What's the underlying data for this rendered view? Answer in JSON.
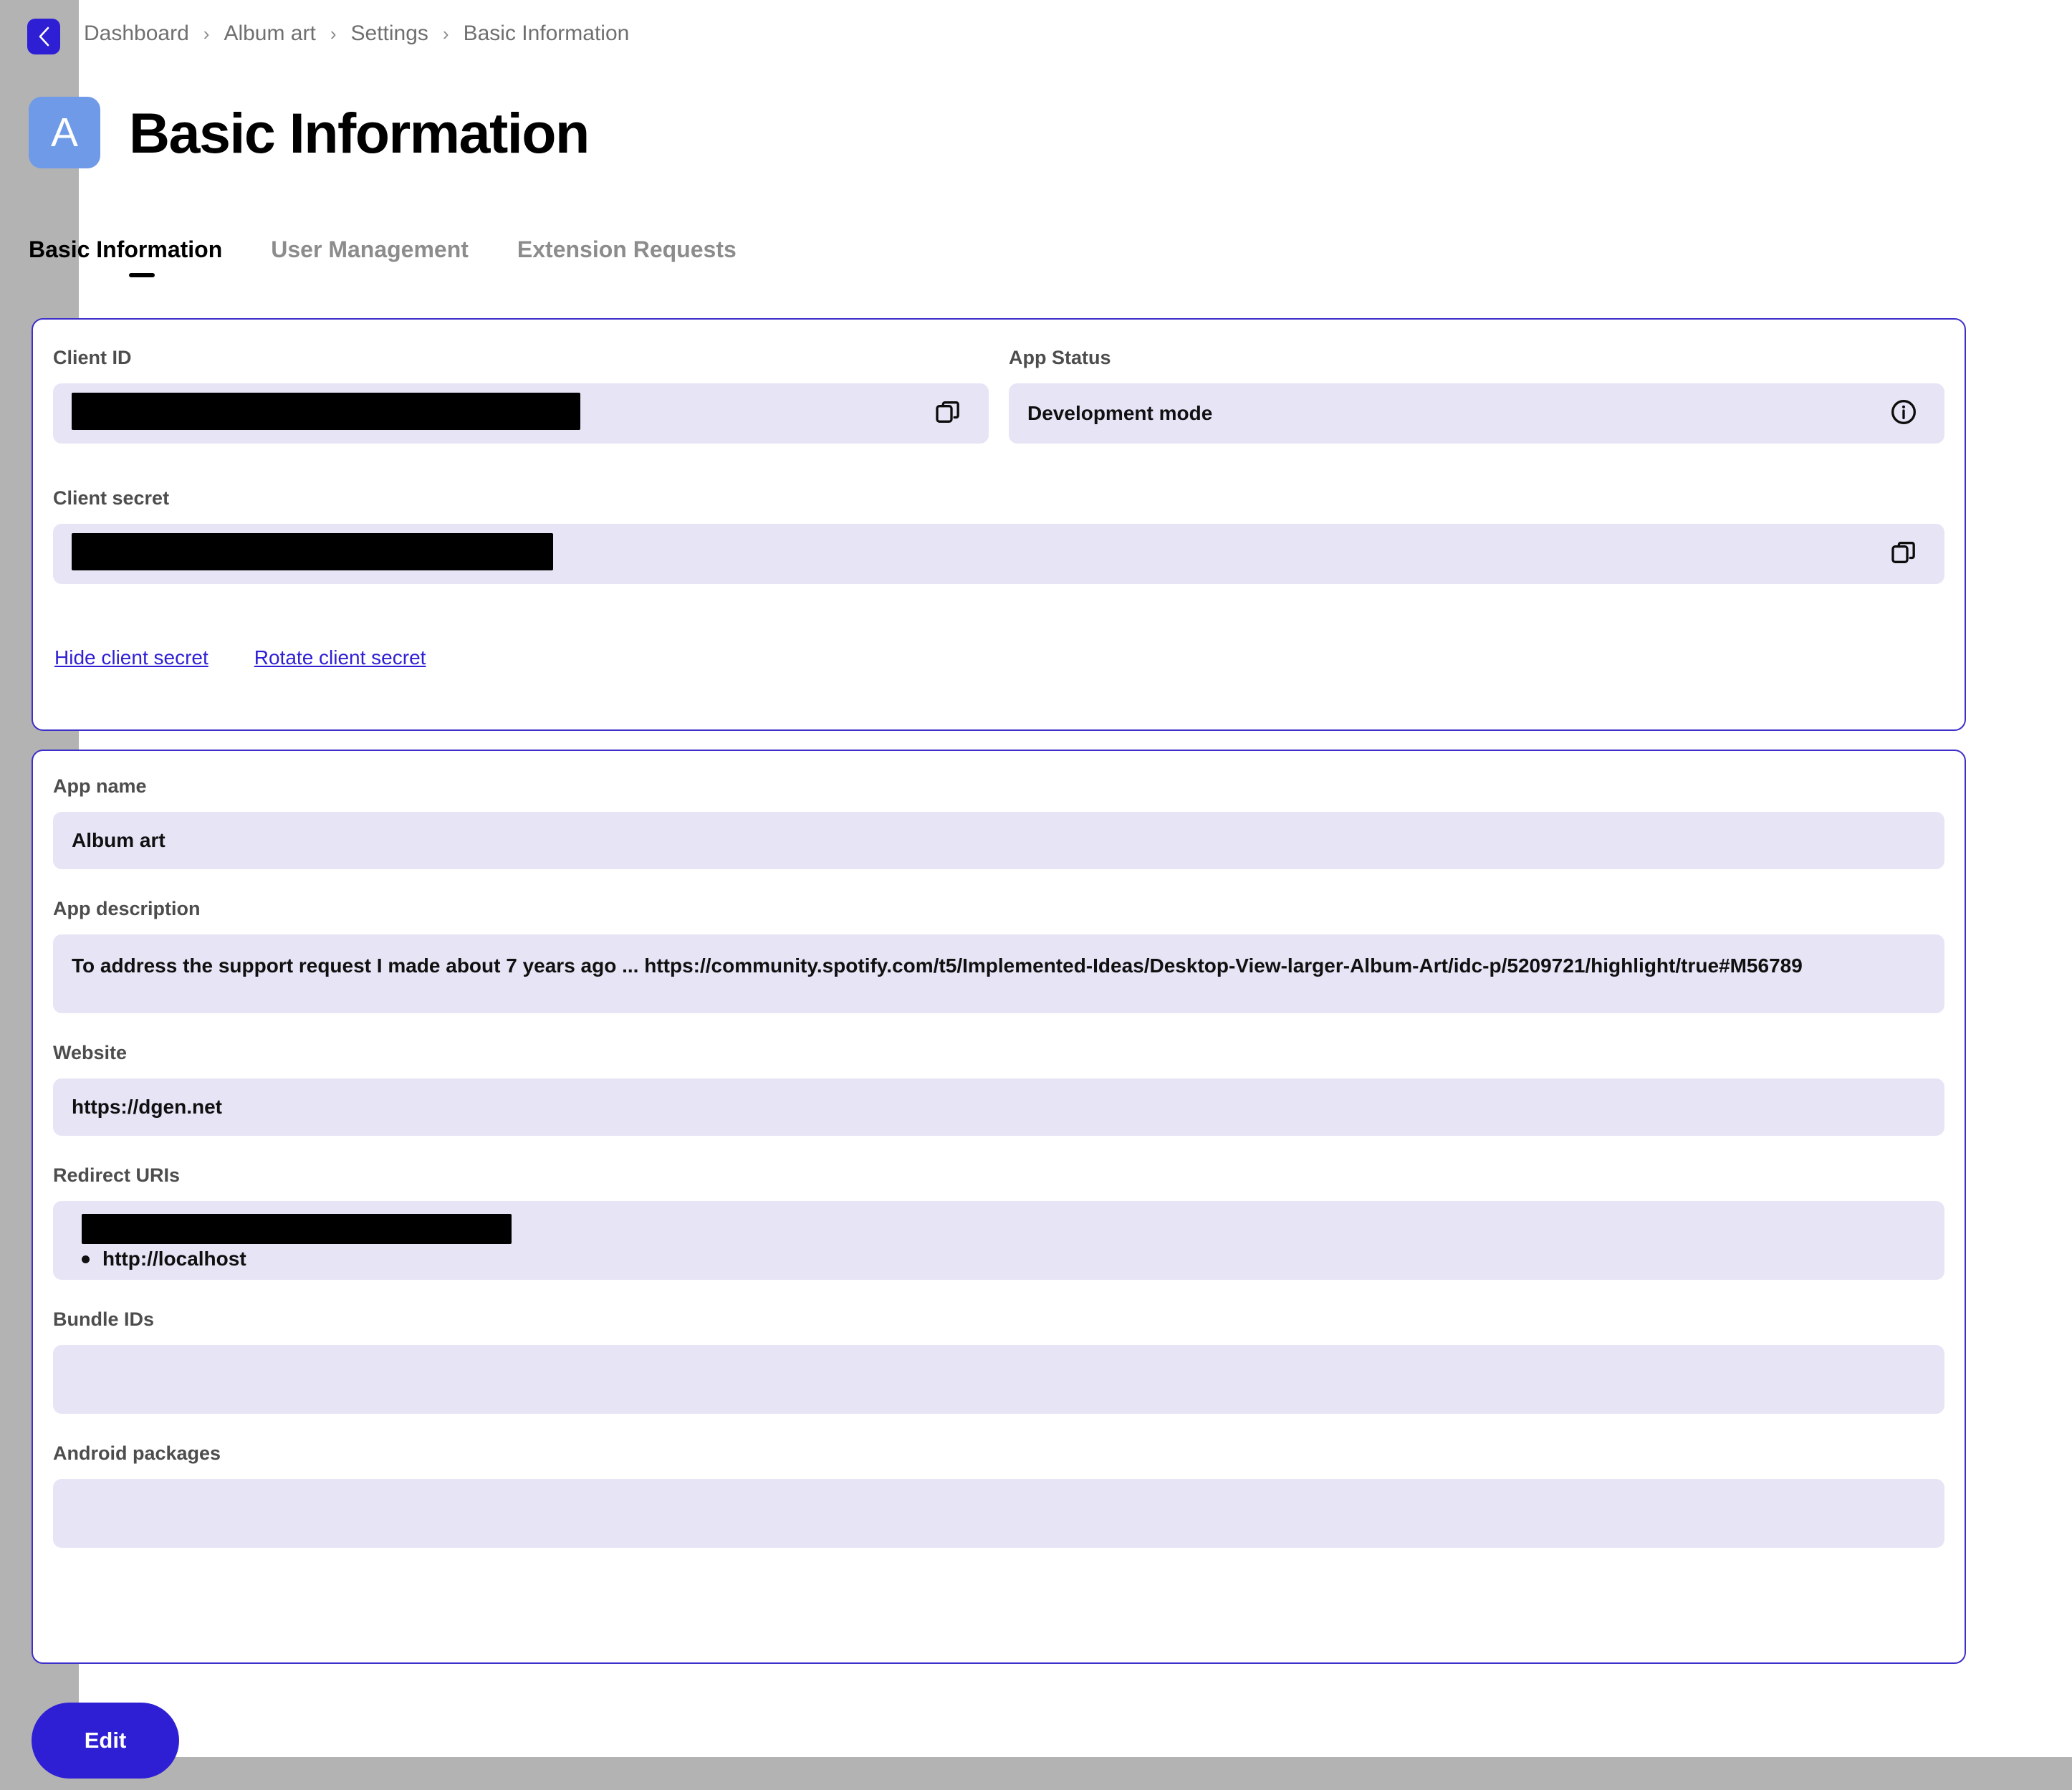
{
  "breadcrumb": {
    "back_icon": "chevron-left-icon",
    "separator": "›",
    "items": [
      "Dashboard",
      "Album art",
      "Settings",
      "Basic Information"
    ]
  },
  "header": {
    "avatar_letter": "A",
    "title": "Basic Information"
  },
  "tabs": [
    {
      "label": "Basic Information",
      "active": true
    },
    {
      "label": "User Management",
      "active": false
    },
    {
      "label": "Extension Requests",
      "active": false
    }
  ],
  "credentials": {
    "client_id": {
      "label": "Client ID",
      "value": "",
      "redacted": true,
      "copy_icon": "copy-icon"
    },
    "app_status": {
      "label": "App Status",
      "value": "Development mode",
      "info_icon": "info-icon"
    },
    "client_secret": {
      "label": "Client secret",
      "value": "",
      "redacted": true,
      "copy_icon": "copy-icon"
    },
    "links": [
      {
        "label": "Hide client secret"
      },
      {
        "label": "Rotate client secret"
      }
    ]
  },
  "details": {
    "app_name": {
      "label": "App name",
      "value": "Album art"
    },
    "app_description": {
      "label": "App description",
      "value": "To address the support request I made about 7 years ago ... https://community.spotify.com/t5/Implemented-Ideas/Desktop-View-larger-Album-Art/idc-p/5209721/highlight/true#M56789"
    },
    "website": {
      "label": "Website",
      "value": "https://dgen.net"
    },
    "redirect_uris": {
      "label": "Redirect URIs",
      "items": [
        {
          "value": "",
          "redacted": true
        },
        {
          "value": "http://localhost",
          "redacted": false
        }
      ]
    },
    "bundle_ids": {
      "label": "Bundle IDs",
      "value": ""
    },
    "android_packages": {
      "label": "Android packages",
      "value": ""
    }
  },
  "footer": {
    "edit_label": "Edit"
  },
  "colors": {
    "accent": "#2f1fd4",
    "card_border": "#3d2fc9",
    "field_bg": "#e7e4f6",
    "avatar_bg": "#6f9ae8",
    "page_bg": "#b3b3b3"
  }
}
